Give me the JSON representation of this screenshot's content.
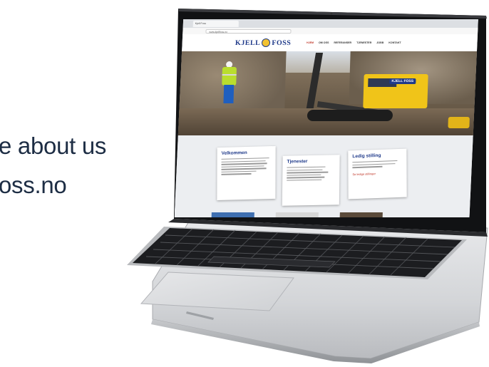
{
  "page": {
    "headline_line1": "e about us",
    "headline_line2": "oss.no"
  },
  "browser": {
    "tab_title": "Kjell Foss",
    "url": "www.kjellfoss.no"
  },
  "site": {
    "logo_left": "KJELL",
    "logo_right": "FOSS",
    "nav": [
      "HJEM",
      "OM OSS",
      "REFERANSER",
      "TJENESTER",
      "JOBB",
      "KONTAKT"
    ],
    "nav_active_index": 0,
    "hero_machine_logo": "KJELL FOSS",
    "cards": [
      {
        "title": "Velkommen"
      },
      {
        "title": "Tjenester"
      },
      {
        "title": "Ledig stilling",
        "link": "Se ledige stillinger"
      }
    ]
  },
  "colors": {
    "headline": "#1d2d44",
    "brand_blue": "#1f3a8a",
    "brand_yellow": "#f2c230",
    "accent_red": "#c0392b"
  }
}
